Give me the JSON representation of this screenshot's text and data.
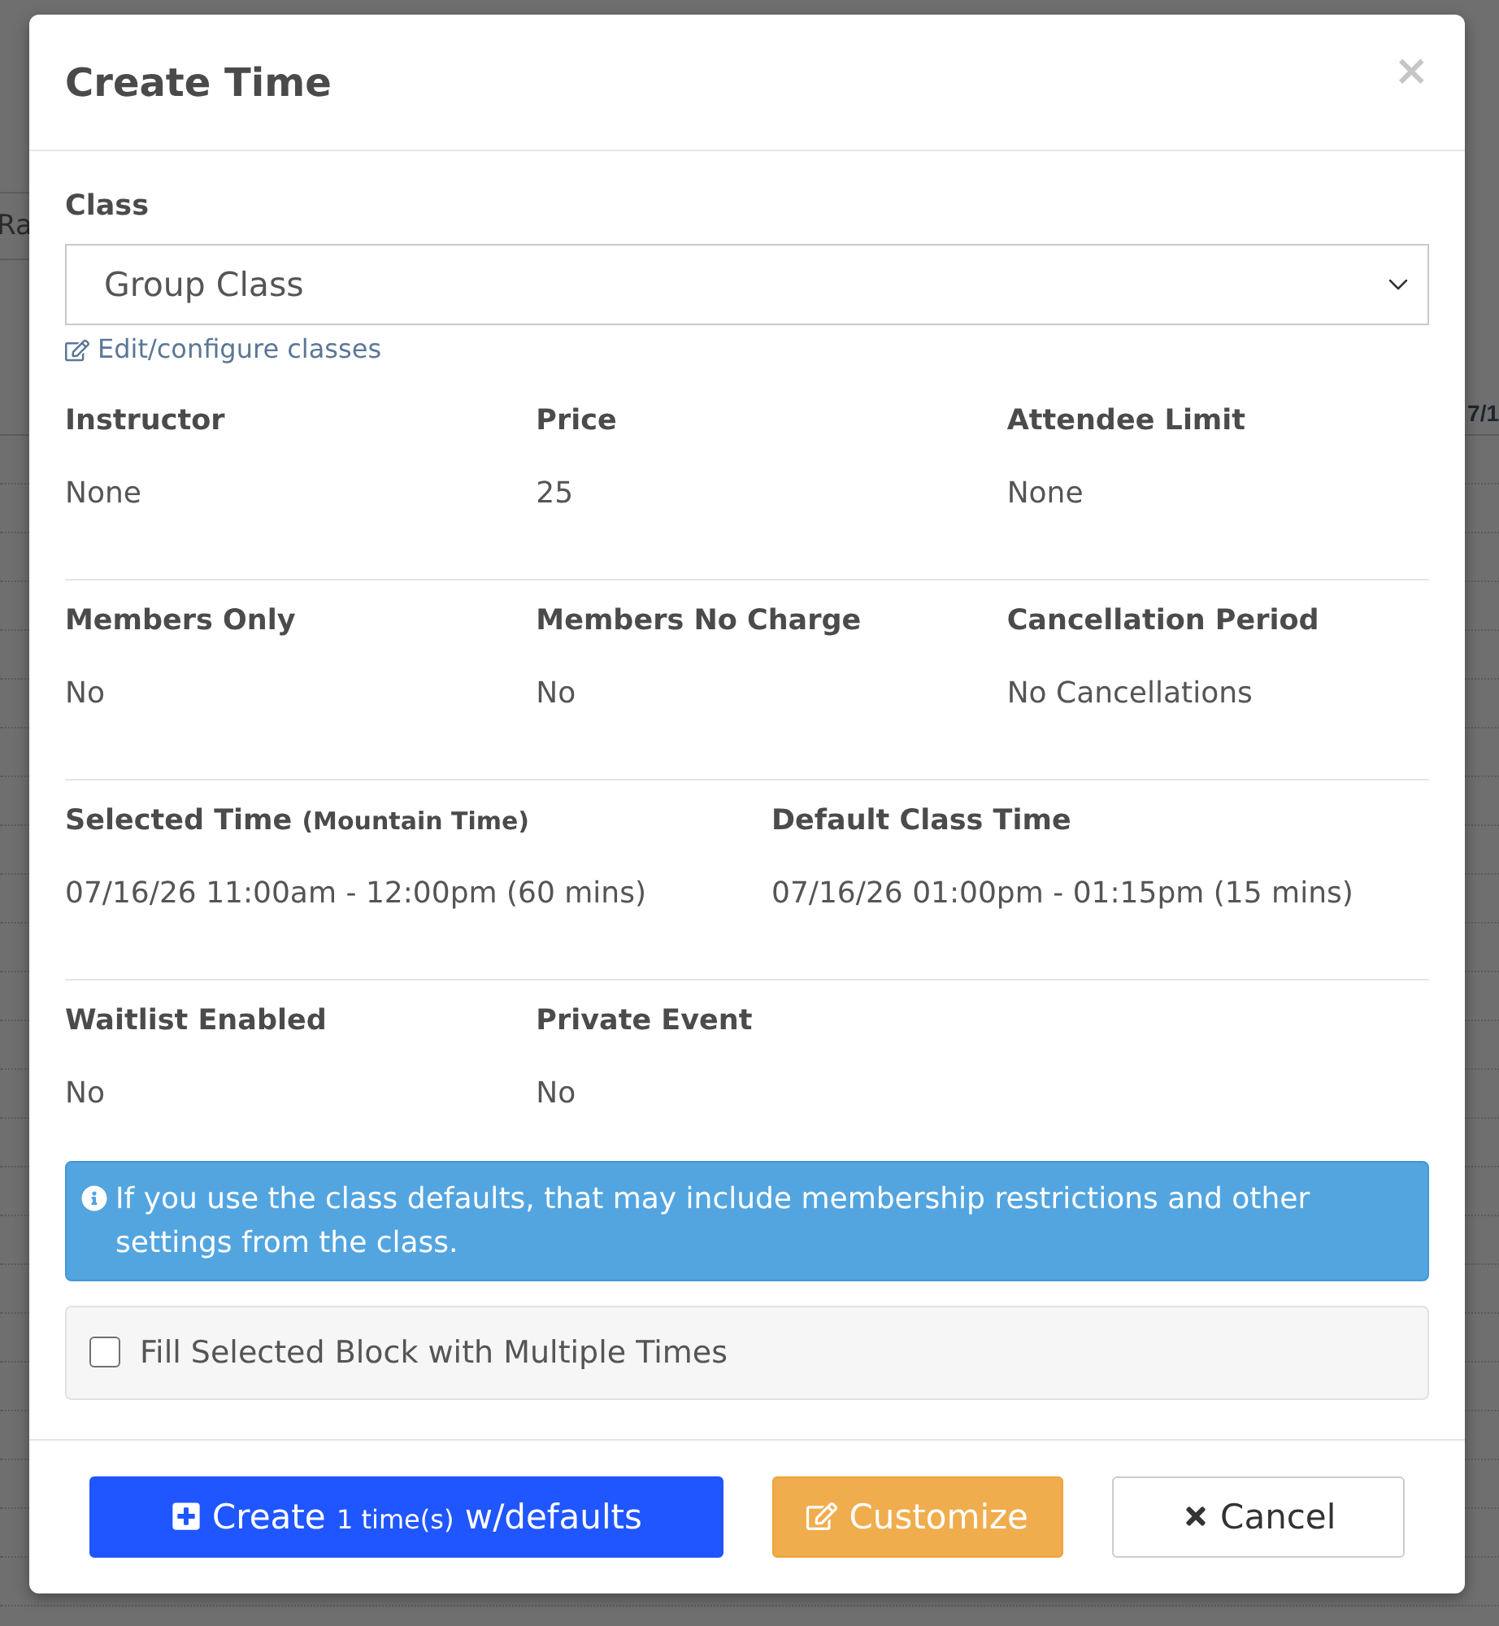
{
  "backdrop": {
    "cell_text": "Ra",
    "header_text": "7/1"
  },
  "dialog": {
    "title": "Create Time",
    "close": "×"
  },
  "class_field": {
    "label": "Class",
    "value": "Group Class",
    "link": "Edit/configure classes"
  },
  "sections": [
    {
      "fields": [
        {
          "kind": "standard",
          "label": "Instructor",
          "value": "None"
        },
        {
          "kind": "standard",
          "label": "Price",
          "value": "25"
        },
        {
          "kind": "standard",
          "label": "Attendee Limit",
          "value": "None"
        }
      ]
    },
    {
      "fields": [
        {
          "kind": "standard",
          "label": "Members Only",
          "value": "No"
        },
        {
          "kind": "standard",
          "label": "Members No Charge",
          "value": "No"
        },
        {
          "kind": "standard",
          "label": "Cancellation Period",
          "value": "No Cancellations"
        }
      ]
    },
    {
      "fields": [
        {
          "kind": "wide",
          "label": "Selected Time",
          "note": "(Mountain Time)",
          "value": "07/16/26 11:00am - 12:00pm (60 mins)"
        },
        {
          "kind": "wide",
          "label": "Default Class Time",
          "value": "07/16/26 01:00pm - 01:15pm (15 mins)"
        }
      ]
    },
    {
      "fields": [
        {
          "kind": "standard",
          "label": "Waitlist Enabled",
          "value": "No"
        },
        {
          "kind": "standard",
          "label": "Private Event",
          "value": "No"
        }
      ]
    }
  ],
  "notice": {
    "text": "If you use the class defaults, that may include membership restrictions and other settings from the class."
  },
  "multiple_times": {
    "label": "Fill Selected Block with Multiple Times",
    "checked": false
  },
  "buttons": [
    {
      "kind": "primary",
      "label": "Create",
      "count": "1 time(s)",
      "suffix": "w/defaults"
    },
    {
      "kind": "warning",
      "label": "Customize"
    },
    {
      "kind": "default",
      "label": "Cancel"
    }
  ]
}
